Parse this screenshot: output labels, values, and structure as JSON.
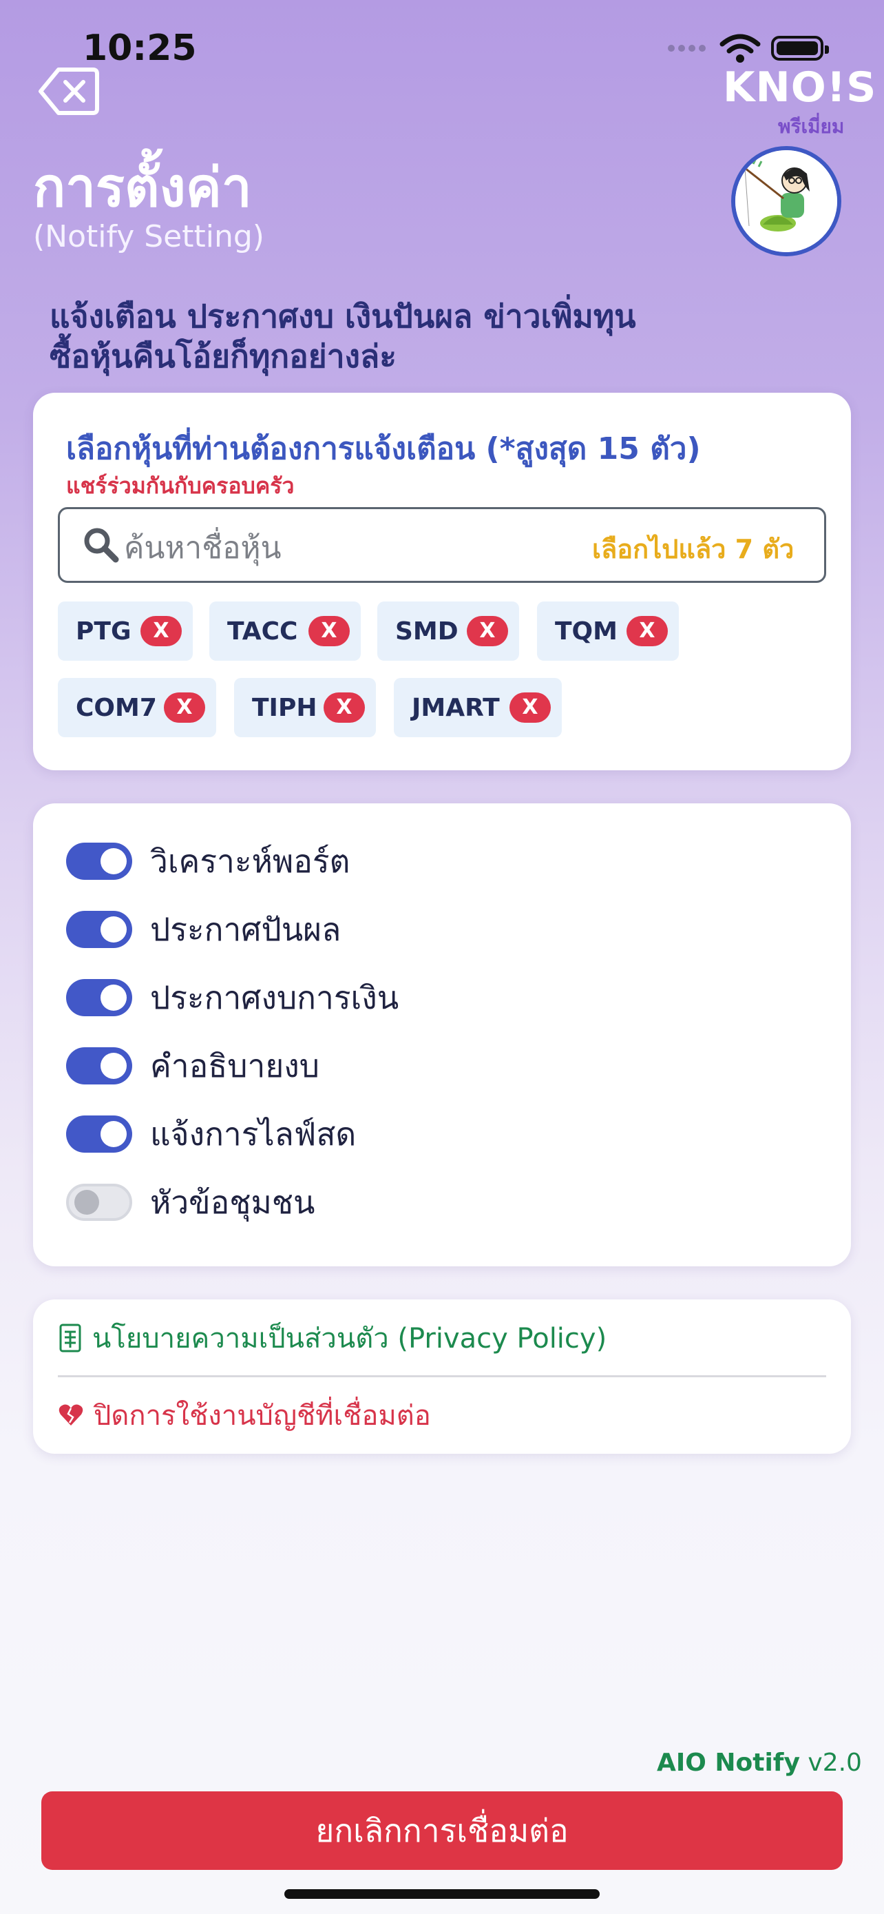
{
  "status_bar": {
    "time": "10:25"
  },
  "brand": {
    "logo": "KNO!S",
    "tier": "พรีเมี่ยม"
  },
  "header": {
    "title": "การตั้งค่า",
    "subtitle": "(Notify Setting)"
  },
  "headline": {
    "line1": "แจ้งเตือน ประกาศงบ เงินปันผล ข่าวเพิ่มทุน",
    "line2": "ซื้อหุ้นคืนโอ้ยก็ทุกอย่างล่ะ"
  },
  "stock_picker": {
    "title": "เลือกหุ้นที่ท่านต้องการแจ้งเตือน (*สูงสุด 15 ตัว)",
    "share_note": "แชร์ร่วมกันกับครอบครัว",
    "search_placeholder": "ค้นหาชื่อหุ้น",
    "selected_count": "เลือกไปแล้ว 7 ตัว",
    "remove_label": "X",
    "chips": [
      "PTG",
      "TACC",
      "SMD",
      "TQM",
      "COM7",
      "TIPH",
      "JMART"
    ]
  },
  "toggles": [
    {
      "label": "วิเคราะห์พอร์ต",
      "on": true
    },
    {
      "label": "ประกาศปันผล",
      "on": true
    },
    {
      "label": "ประกาศงบการเงิน",
      "on": true
    },
    {
      "label": "คำอธิบายงบ",
      "on": true
    },
    {
      "label": "แจ้งการไลฟ์สด",
      "on": true
    },
    {
      "label": "หัวข้อชุมชน",
      "on": false
    }
  ],
  "links": {
    "privacy": "นโยบายความเป็นส่วนตัว (Privacy Policy)",
    "disconnect": "ปิดการใช้งานบัญชีที่เชื่อมต่อ"
  },
  "footer": {
    "app_name": "AIO Notify",
    "version": "v2.0",
    "cancel_button": "ยกเลิกการเชื่อมต่อ"
  },
  "colors": {
    "accent": "#4258c8",
    "danger": "#de3545",
    "success": "#1c8a4e",
    "highlight": "#e8ac1c"
  },
  "icons": [
    "back-icon",
    "search-icon",
    "remove-icon",
    "document-icon",
    "broken-heart-icon",
    "wifi-icon",
    "battery-icon"
  ]
}
